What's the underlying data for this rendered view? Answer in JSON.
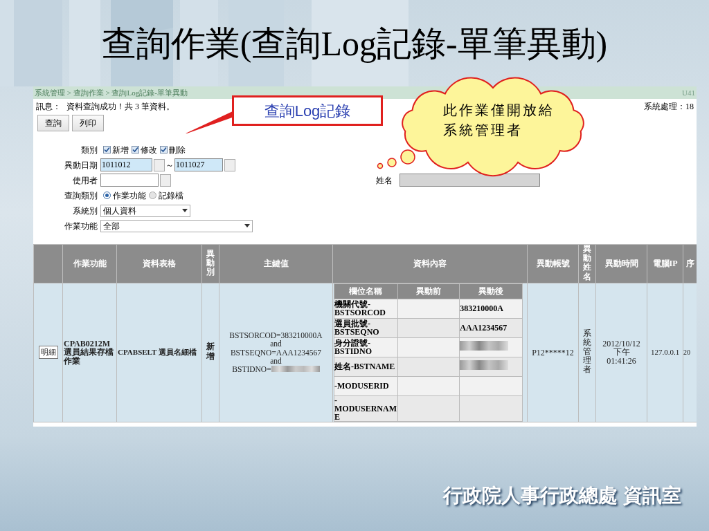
{
  "slide": {
    "title": "查詢作業(查詢Log記錄-單筆異動)",
    "footer": "行政院人事行政總處 資訊室"
  },
  "screen": {
    "breadcrumb": "系統管理 > 查詢作業 > 查詢Log記錄-單筆異動",
    "page_code": "U41",
    "message_label": "訊息：",
    "message": "資料查詢成功！共 3 筆資料。",
    "system_info": "系統處理：18",
    "buttons": [
      "查詢",
      "列印"
    ],
    "form": {
      "category": {
        "label": "類別",
        "options": [
          {
            "label": "新增",
            "checked": true
          },
          {
            "label": "修改",
            "checked": true
          },
          {
            "label": "刪除",
            "checked": true
          }
        ]
      },
      "date": {
        "label": "異動日期",
        "from": "1011012",
        "separator": "～",
        "to": "1011027"
      },
      "user": {
        "label": "使用者"
      },
      "name": {
        "label": "姓名",
        "disabled": true
      },
      "query_type": {
        "label": "查詢類別",
        "options": [
          {
            "label": "作業功能",
            "selected": true
          },
          {
            "label": "記錄檔",
            "selected": false
          }
        ]
      },
      "system": {
        "label": "系統別",
        "value": "個人資料"
      },
      "function": {
        "label": "作業功能",
        "value": "全部"
      }
    }
  },
  "callouts": [
    {
      "kind": "box",
      "text": "查詢Log記錄"
    },
    {
      "kind": "cloud",
      "lines": [
        "此作業僅開放給",
        "系統管理者"
      ]
    }
  ],
  "table": {
    "columns": [
      "作業功能",
      "資料表格",
      "異動別",
      "主鍵值",
      "資料內容",
      "異動帳號",
      "異動姓名",
      "異動時間",
      "電腦IP",
      "序"
    ],
    "rows": [
      {
        "button": "明細",
        "function": "CPAB0212M 選員結果存檔作業",
        "data_table": "CPABSELT 選員名細檔",
        "change_type": "新增",
        "key_lines": [
          {
            "text": "BSTSORCOD=383210000A",
            "redacted": false
          },
          {
            "text": "and",
            "redacted": false
          },
          {
            "text": "BSTSEQNO=AAA1234567",
            "redacted": false
          },
          {
            "text": "and",
            "redacted": false
          },
          {
            "text": "BSTIDNO=",
            "redacted": true
          }
        ],
        "content": {
          "columns": [
            "欄位名稱",
            "異動前",
            "異動後"
          ],
          "rows": [
            {
              "field": "機關代號-BSTSORCOD",
              "after": "383210000A",
              "redacted": false
            },
            {
              "field": "選員批號-BSTSEQNO",
              "after": "AAA1234567",
              "redacted": false
            },
            {
              "field": "身分證號-BSTIDNO",
              "redacted": true
            },
            {
              "field": "姓名-BSTNAME",
              "redacted": true
            },
            {
              "field": "-MODUSERID",
              "redacted": false
            },
            {
              "field": "-MODUSERNAME",
              "redacted": false
            }
          ]
        },
        "account": "P12*****12",
        "user_name": "系統管理者",
        "time": "2012/10/12 下午 01:41:26",
        "ip": "127.0.0.1",
        "seq": "20"
      }
    ]
  }
}
